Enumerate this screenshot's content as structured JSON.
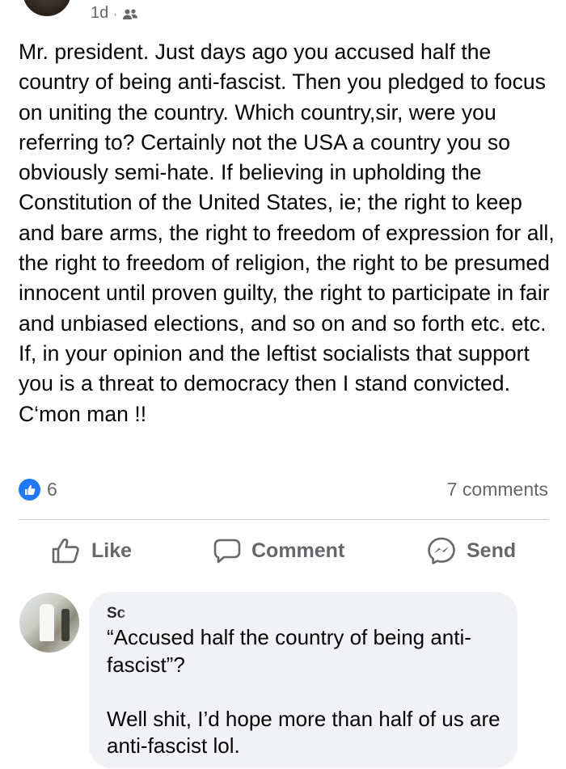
{
  "header": {
    "time": "1d",
    "separator": "·",
    "audience_icon": "friends-icon"
  },
  "post": {
    "text": "Mr. president. Just days ago you accused half the country of being anti-fascist. Then you pledged to focus on uniting the country. Which country,sir, were you referring to? Certainly not the USA a country you so obviously semi-hate. If believing in upholding the Constitution of the United States, ie; the right to keep and bare arms, the right to freedom of expression for all, the right to freedom of religion, the right to be presumed innocent until proven guilty, the right to participate in fair and unbiased elections, and so on and so forth etc. etc. If, in your opinion and the leftist socialists that support you is a threat to democracy then I stand convicted. C‘mon man !!"
  },
  "reactions": {
    "like_count": "6",
    "comments_count": "7 comments",
    "like_color": "#2078f4"
  },
  "actions": {
    "like_label": "Like",
    "comment_label": "Comment",
    "send_label": "Send"
  },
  "comment": {
    "author": "Sc",
    "text": "“Accused half the country of being anti-fascist”?\n\nWell shit, I’d hope more than half of us are anti-fascist lol."
  }
}
